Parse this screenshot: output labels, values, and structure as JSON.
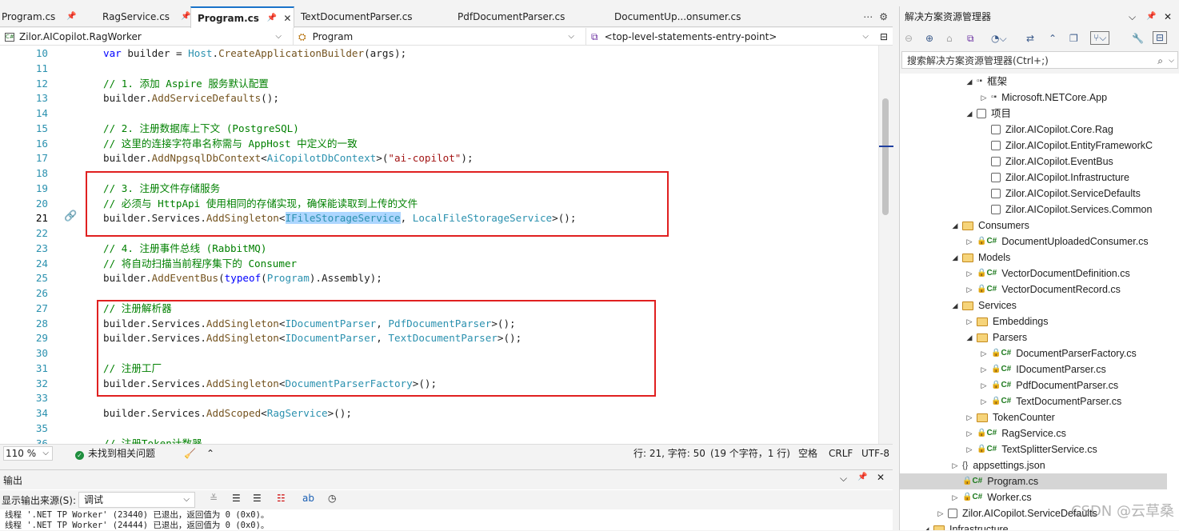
{
  "tabs": [
    {
      "label": "Program.cs",
      "pinned": true,
      "active": false
    },
    {
      "label": "RagService.cs",
      "pinned": true,
      "active": false
    },
    {
      "label": "Program.cs",
      "pinned": true,
      "active": true,
      "close": "✕"
    },
    {
      "label": "TextDocumentParser.cs",
      "active": false
    },
    {
      "label": "PdfDocumentParser.cs",
      "active": false
    },
    {
      "label": "DocumentUp...onsumer.cs",
      "active": false
    }
  ],
  "navbar": {
    "project": "Zilor.AICopilot.RagWorker",
    "type": "Program",
    "member": "<top-level-statements-entry-point>"
  },
  "editor": {
    "lines": [
      {
        "n": "10",
        "segs": [
          [
            "kw",
            "var"
          ],
          [
            "pl",
            " builder = "
          ],
          [
            "ty",
            "Host"
          ],
          [
            "pl",
            "."
          ],
          [
            "mt",
            "CreateApplicationBuilder"
          ],
          [
            "pl",
            "(args);"
          ]
        ]
      },
      {
        "n": "11",
        "segs": []
      },
      {
        "n": "12",
        "segs": [
          [
            "cm",
            "// 1. 添加 Aspire 服务默认配置"
          ]
        ]
      },
      {
        "n": "13",
        "segs": [
          [
            "pl",
            "builder."
          ],
          [
            "mt",
            "AddServiceDefaults"
          ],
          [
            "pl",
            "();"
          ]
        ]
      },
      {
        "n": "14",
        "segs": []
      },
      {
        "n": "15",
        "segs": [
          [
            "cm",
            "// 2. 注册数据库上下文 (PostgreSQL)"
          ]
        ]
      },
      {
        "n": "16",
        "segs": [
          [
            "cm",
            "// 这里的连接字符串名称需与 AppHost 中定义的一致"
          ]
        ]
      },
      {
        "n": "17",
        "segs": [
          [
            "pl",
            "builder."
          ],
          [
            "mt",
            "AddNpgsqlDbContext"
          ],
          [
            "pl",
            "<"
          ],
          [
            "ty",
            "AiCopilotDbContext"
          ],
          [
            "pl",
            ">("
          ],
          [
            "st",
            "\"ai-copilot\""
          ],
          [
            "pl",
            ");"
          ]
        ]
      },
      {
        "n": "18",
        "segs": []
      },
      {
        "n": "19",
        "segs": [
          [
            "cm",
            "// 3. 注册文件存储服务"
          ]
        ]
      },
      {
        "n": "20",
        "segs": [
          [
            "cm",
            "// 必须与 HttpApi 使用相同的存储实现，确保能读取到上传的文件"
          ]
        ]
      },
      {
        "n": "21",
        "segs": [
          [
            "pl",
            "builder.Services."
          ],
          [
            "mt",
            "AddSingleton"
          ],
          [
            "pl",
            "<"
          ],
          [
            "tysel",
            "IFileStorageService"
          ],
          [
            "pl",
            ", "
          ],
          [
            "ty",
            "LocalFileStorageService"
          ],
          [
            "pl",
            ">();"
          ]
        ]
      },
      {
        "n": "22",
        "segs": []
      },
      {
        "n": "23",
        "segs": [
          [
            "cm",
            "// 4. 注册事件总线 (RabbitMQ)"
          ]
        ]
      },
      {
        "n": "24",
        "segs": [
          [
            "cm",
            "// 将自动扫描当前程序集下的 Consumer"
          ]
        ]
      },
      {
        "n": "25",
        "segs": [
          [
            "pl",
            "builder."
          ],
          [
            "mt",
            "AddEventBus"
          ],
          [
            "pl",
            "("
          ],
          [
            "kw",
            "typeof"
          ],
          [
            "pl",
            "("
          ],
          [
            "ty",
            "Program"
          ],
          [
            "pl",
            ").Assembly);"
          ]
        ]
      },
      {
        "n": "26",
        "segs": []
      },
      {
        "n": "27",
        "segs": [
          [
            "cm",
            "// 注册解析器"
          ]
        ]
      },
      {
        "n": "28",
        "segs": [
          [
            "pl",
            "builder.Services."
          ],
          [
            "mt",
            "AddSingleton"
          ],
          [
            "pl",
            "<"
          ],
          [
            "ty",
            "IDocumentParser"
          ],
          [
            "pl",
            ", "
          ],
          [
            "ty",
            "PdfDocumentParser"
          ],
          [
            "pl",
            ">();"
          ]
        ]
      },
      {
        "n": "29",
        "segs": [
          [
            "pl",
            "builder.Services."
          ],
          [
            "mt",
            "AddSingleton"
          ],
          [
            "pl",
            "<"
          ],
          [
            "ty",
            "IDocumentParser"
          ],
          [
            "pl",
            ", "
          ],
          [
            "ty",
            "TextDocumentParser"
          ],
          [
            "pl",
            ">();"
          ]
        ]
      },
      {
        "n": "30",
        "segs": []
      },
      {
        "n": "31",
        "segs": [
          [
            "cm",
            "// 注册工厂"
          ]
        ]
      },
      {
        "n": "32",
        "segs": [
          [
            "pl",
            "builder.Services."
          ],
          [
            "mt",
            "AddSingleton"
          ],
          [
            "pl",
            "<"
          ],
          [
            "ty",
            "DocumentParserFactory"
          ],
          [
            "pl",
            ">();"
          ]
        ]
      },
      {
        "n": "33",
        "segs": []
      },
      {
        "n": "34",
        "segs": [
          [
            "pl",
            "builder.Services."
          ],
          [
            "mt",
            "AddScoped"
          ],
          [
            "pl",
            "<"
          ],
          [
            "ty",
            "RagService"
          ],
          [
            "pl",
            ">();"
          ]
        ]
      },
      {
        "n": "35",
        "segs": []
      },
      {
        "n": "36",
        "segs": [
          [
            "cm",
            "// 注册Token计数器"
          ]
        ]
      }
    ],
    "current_line": "21"
  },
  "status": {
    "zoom": "110 %",
    "issues": "未找到相关问题",
    "position": "行: 21, 字符: 50",
    "selection": "(19 个字符，1 行)",
    "whitespace": "空格",
    "line_ending": "CRLF",
    "encoding": "UTF-8"
  },
  "output": {
    "title": "输出",
    "source_label": "显示输出来源(S):",
    "source_value": "调试",
    "lines": [
      "线程 '.NET TP Worker' (23440) 已退出，返回值为 0 (0x0)。",
      "线程 '.NET TP Worker' (24444) 已退出，返回值为 0 (0x0)。"
    ]
  },
  "solution_explorer": {
    "title": "解决方案资源管理器",
    "search_placeholder": "搜索解决方案资源管理器(Ctrl+;)",
    "items": [
      {
        "label": "框架",
        "indent": 1,
        "toggle": "◢",
        "icon": "ref"
      },
      {
        "label": "Microsoft.NETCore.App",
        "indent": 2,
        "toggle": "▷",
        "icon": "ref"
      },
      {
        "label": "项目",
        "indent": 1,
        "toggle": "◢",
        "icon": "proj"
      },
      {
        "label": "Zilor.AICopilot.Core.Rag",
        "indent": 2,
        "toggle": "",
        "icon": "proj"
      },
      {
        "label": "Zilor.AICopilot.EntityFrameworkC",
        "indent": 2,
        "toggle": "",
        "icon": "proj"
      },
      {
        "label": "Zilor.AICopilot.EventBus",
        "indent": 2,
        "toggle": "",
        "icon": "proj"
      },
      {
        "label": "Zilor.AICopilot.Infrastructure",
        "indent": 2,
        "toggle": "",
        "icon": "proj"
      },
      {
        "label": "Zilor.AICopilot.ServiceDefaults",
        "indent": 2,
        "toggle": "",
        "icon": "proj"
      },
      {
        "label": "Zilor.AICopilot.Services.Common",
        "indent": 2,
        "toggle": "",
        "icon": "proj"
      },
      {
        "label": "Consumers",
        "indent": 0,
        "toggle": "◢",
        "icon": "folder"
      },
      {
        "label": "DocumentUploadedConsumer.cs",
        "indent": 1,
        "toggle": "▷",
        "icon": "cs"
      },
      {
        "label": "Models",
        "indent": 0,
        "toggle": "◢",
        "icon": "folder"
      },
      {
        "label": "VectorDocumentDefinition.cs",
        "indent": 1,
        "toggle": "▷",
        "icon": "cs"
      },
      {
        "label": "VectorDocumentRecord.cs",
        "indent": 1,
        "toggle": "▷",
        "icon": "cs"
      },
      {
        "label": "Services",
        "indent": 0,
        "toggle": "◢",
        "icon": "folder"
      },
      {
        "label": "Embeddings",
        "indent": 1,
        "toggle": "▷",
        "icon": "folder"
      },
      {
        "label": "Parsers",
        "indent": 1,
        "toggle": "◢",
        "icon": "folder"
      },
      {
        "label": "DocumentParserFactory.cs",
        "indent": 2,
        "toggle": "▷",
        "icon": "cs"
      },
      {
        "label": "IDocumentParser.cs",
        "indent": 2,
        "toggle": "▷",
        "icon": "cs"
      },
      {
        "label": "PdfDocumentParser.cs",
        "indent": 2,
        "toggle": "▷",
        "icon": "cs"
      },
      {
        "label": "TextDocumentParser.cs",
        "indent": 2,
        "toggle": "▷",
        "icon": "cs"
      },
      {
        "label": "TokenCounter",
        "indent": 1,
        "toggle": "▷",
        "icon": "folder"
      },
      {
        "label": "RagService.cs",
        "indent": 1,
        "toggle": "▷",
        "icon": "cs"
      },
      {
        "label": "TextSplitterService.cs",
        "indent": 1,
        "toggle": "▷",
        "icon": "cs"
      },
      {
        "label": "appsettings.json",
        "indent": 0,
        "toggle": "▷",
        "icon": "json"
      },
      {
        "label": "Program.cs",
        "indent": 0,
        "toggle": "",
        "icon": "cs",
        "selected": true
      },
      {
        "label": "Worker.cs",
        "indent": 0,
        "toggle": "▷",
        "icon": "cs"
      },
      {
        "label": "Zilor.AICopilot.ServiceDefaults",
        "indent": -1,
        "toggle": "▷",
        "icon": "proj"
      },
      {
        "label": "Infrastructure",
        "indent": -2,
        "toggle": "◢",
        "icon": "folder"
      }
    ],
    "watermark": "CSDN @云草桑"
  }
}
